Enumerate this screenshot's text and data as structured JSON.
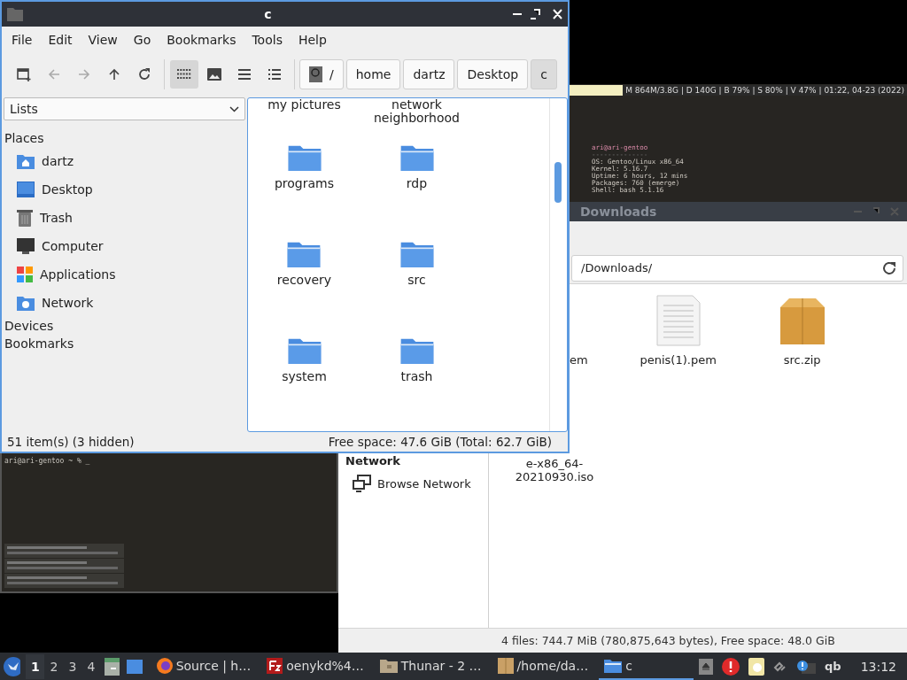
{
  "top_terminal": {
    "status_text": "M 864M/3.8G | D 140G | B 79% | S 80% | V 47% | 01:22, 04-23 (2022)",
    "lines": [
      {
        "text": "ari@ari-gentoo",
        "kind": "title"
      },
      {
        "text": "--------------",
        "kind": "rule"
      },
      {
        "text": "OS: Gentoo/Linux x86_64",
        "kind": "info"
      },
      {
        "text": "Kernel: 5.16.7",
        "kind": "info"
      },
      {
        "text": "Uptime: 6 hours, 12 mins",
        "kind": "info"
      },
      {
        "text": "Packages: 760 (emerge)",
        "kind": "info"
      },
      {
        "text": "Shell: bash 5.1.16",
        "kind": "info"
      }
    ]
  },
  "downloads_window": {
    "title": "Downloads",
    "address": "/Downloads/",
    "sidebar": {
      "section": "Network",
      "items": [
        "Browse Network"
      ]
    },
    "files": [
      {
        "name": "em",
        "kind": "partial"
      },
      {
        "name": "penis(1).pem",
        "kind": "text"
      },
      {
        "name": "src.zip",
        "kind": "archive"
      },
      {
        "name": "e-x86_64-20210930.iso",
        "kind": "hidden-icon"
      }
    ],
    "status": "4 files: 744.7 MiB (780,875,643 bytes), Free space: 48.0 GiB"
  },
  "bottom_terminal": {
    "prompt": "ari@ari-gentoo ~ % _"
  },
  "file_manager": {
    "title": "c",
    "menu": [
      "File",
      "Edit",
      "View",
      "Go",
      "Bookmarks",
      "Tools",
      "Help"
    ],
    "nav_buttons": [
      {
        "kind": "new-window",
        "disabled": false
      },
      {
        "kind": "back",
        "disabled": true
      },
      {
        "kind": "forward",
        "disabled": true
      },
      {
        "kind": "up",
        "disabled": false
      },
      {
        "kind": "reload",
        "disabled": false
      }
    ],
    "view_buttons": [
      {
        "kind": "icons",
        "selected": true
      },
      {
        "kind": "thumbnails",
        "selected": false
      },
      {
        "kind": "compact",
        "selected": false
      },
      {
        "kind": "details",
        "selected": false
      }
    ],
    "breadcrumbs": [
      {
        "label": "/",
        "kind": "root",
        "selected": false
      },
      {
        "label": "home",
        "kind": "dir",
        "selected": false
      },
      {
        "label": "dartz",
        "kind": "dir",
        "selected": false
      },
      {
        "label": "Desktop",
        "kind": "dir",
        "selected": false
      },
      {
        "label": "c",
        "kind": "dir",
        "selected": true
      }
    ],
    "side_select": "Lists",
    "places_header": "Places",
    "places": [
      {
        "label": "dartz",
        "kind": "home"
      },
      {
        "label": "Desktop",
        "kind": "desktop"
      },
      {
        "label": "Trash",
        "kind": "trash"
      },
      {
        "label": "Computer",
        "kind": "computer"
      },
      {
        "label": "Applications",
        "kind": "apps"
      },
      {
        "label": "Network",
        "kind": "network"
      }
    ],
    "other_headers": [
      "Devices",
      "Bookmarks"
    ],
    "top_labels": [
      "my pictures",
      "network\nneighborhood"
    ],
    "folders": [
      "programs",
      "rdp",
      "recovery",
      "src",
      "system",
      "trash"
    ],
    "status_left": "51 item(s) (3 hidden)",
    "status_right": "Free space: 47.6 GiB (Total: 62.7 GiB)"
  },
  "taskbar": {
    "workspaces": [
      {
        "label": "1",
        "selected": true
      },
      {
        "label": "2",
        "selected": false
      },
      {
        "label": "3",
        "selected": false
      },
      {
        "label": "4",
        "selected": false
      }
    ],
    "tasks": [
      {
        "label": "Source | h…",
        "kind": "browser",
        "selected": false
      },
      {
        "label": "oenykd%4…",
        "kind": "ftp",
        "selected": false
      },
      {
        "label": "Thunar - 2 …",
        "kind": "folder",
        "selected": false
      },
      {
        "label": "/home/da…",
        "kind": "archive",
        "selected": false
      },
      {
        "label": "c",
        "kind": "blue-folder",
        "selected": true
      }
    ],
    "tray_text": "qb",
    "clock": "13:12"
  }
}
